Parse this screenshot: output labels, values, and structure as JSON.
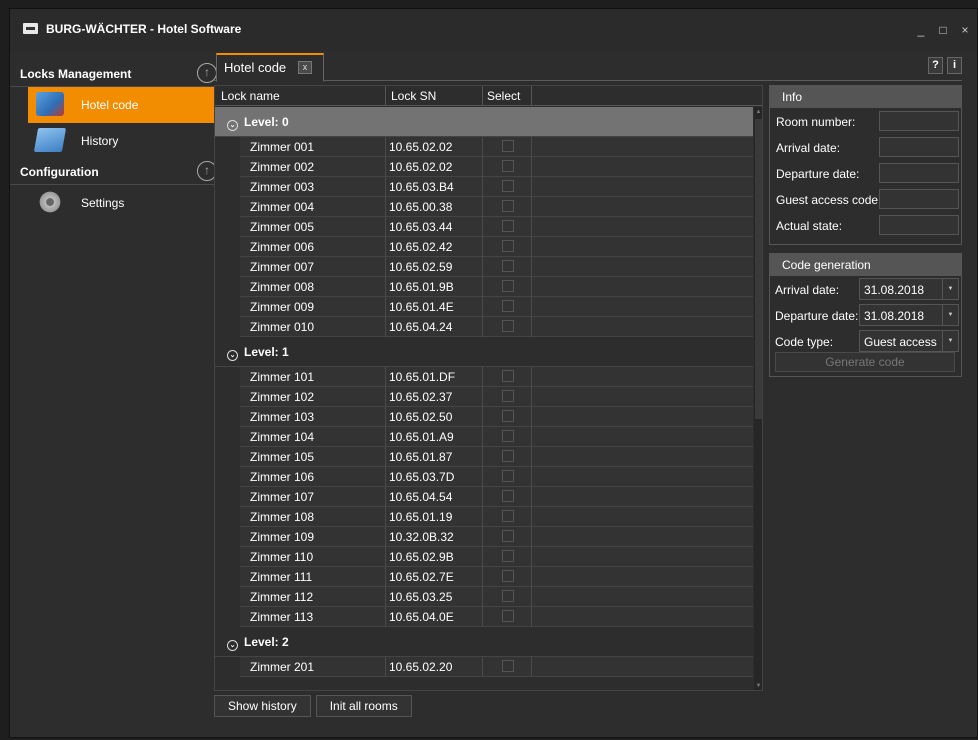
{
  "window": {
    "title": "BURG-WÄCHTER - Hotel Software",
    "minimize": "_",
    "maximize": "□",
    "close": "×"
  },
  "sidebar": {
    "section1": "Locks Management",
    "items1": [
      {
        "label": "Hotel code"
      },
      {
        "label": "History"
      }
    ],
    "section2": "Configuration",
    "items2": [
      {
        "label": "Settings"
      }
    ]
  },
  "tab": {
    "label": "Hotel code",
    "close": "x"
  },
  "help": {
    "question": "?",
    "info": "i"
  },
  "grid": {
    "headers": {
      "name": "Lock name",
      "sn": "Lock SN",
      "select": "Select"
    },
    "levels": [
      {
        "label": "Level: 0",
        "rooms": [
          {
            "name": "Zimmer 001",
            "sn": "10.65.02.02"
          },
          {
            "name": "Zimmer 002",
            "sn": "10.65.02.02"
          },
          {
            "name": "Zimmer 003",
            "sn": "10.65.03.B4"
          },
          {
            "name": "Zimmer 004",
            "sn": "10.65.00.38"
          },
          {
            "name": "Zimmer 005",
            "sn": "10.65.03.44"
          },
          {
            "name": "Zimmer 006",
            "sn": "10.65.02.42"
          },
          {
            "name": "Zimmer 007",
            "sn": "10.65.02.59"
          },
          {
            "name": "Zimmer 008",
            "sn": "10.65.01.9B"
          },
          {
            "name": "Zimmer 009",
            "sn": "10.65.01.4E"
          },
          {
            "name": "Zimmer 010",
            "sn": "10.65.04.24"
          }
        ]
      },
      {
        "label": "Level: 1",
        "rooms": [
          {
            "name": "Zimmer 101",
            "sn": "10.65.01.DF"
          },
          {
            "name": "Zimmer 102",
            "sn": "10.65.02.37"
          },
          {
            "name": "Zimmer 103",
            "sn": "10.65.02.50"
          },
          {
            "name": "Zimmer 104",
            "sn": "10.65.01.A9"
          },
          {
            "name": "Zimmer 105",
            "sn": "10.65.01.87"
          },
          {
            "name": "Zimmer 106",
            "sn": "10.65.03.7D"
          },
          {
            "name": "Zimmer 107",
            "sn": "10.65.04.54"
          },
          {
            "name": "Zimmer 108",
            "sn": "10.65.01.19"
          },
          {
            "name": "Zimmer 109",
            "sn": "10.32.0B.32"
          },
          {
            "name": "Zimmer 110",
            "sn": "10.65.02.9B"
          },
          {
            "name": "Zimmer 111",
            "sn": "10.65.02.7E"
          },
          {
            "name": "Zimmer 112",
            "sn": "10.65.03.25"
          },
          {
            "name": "Zimmer 113",
            "sn": "10.65.04.0E"
          }
        ]
      },
      {
        "label": "Level: 2",
        "rooms": [
          {
            "name": "Zimmer 201",
            "sn": "10.65.02.20"
          }
        ]
      }
    ]
  },
  "buttons": {
    "show_history": "Show history",
    "init_all": "Init all rooms"
  },
  "info": {
    "title": "Info",
    "labels": {
      "room_number": "Room number:",
      "arrival": "Arrival date:",
      "departure": "Departure date:",
      "guest_code": "Guest access code:",
      "state": "Actual state:"
    }
  },
  "codegen": {
    "title": "Code generation",
    "arrival_label": "Arrival date:",
    "arrival_value": "31.08.2018",
    "departure_label": "Departure date:",
    "departure_value": "31.08.2018",
    "type_label": "Code type:",
    "type_value": "Guest access",
    "generate": "Generate code"
  },
  "colors": {
    "accent": "#f28c00",
    "selected_row": "#737373",
    "panel_header": "#555555"
  }
}
